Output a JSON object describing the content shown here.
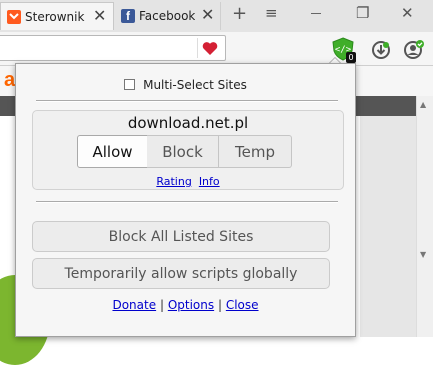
{
  "tabs": [
    {
      "title": "Sterowniki",
      "favicon": "sterowniki-favicon",
      "active": true
    },
    {
      "title": "Facebook",
      "favicon": "facebook-favicon",
      "active": false
    }
  ],
  "window_controls": {
    "new_tab": "+",
    "tab_list": "≡",
    "restore": "❐",
    "close": "✕"
  },
  "page": {
    "logo_char": "a"
  },
  "popup": {
    "multi_select_label": "Multi-Select Sites",
    "multi_select_checked": false,
    "site": "download.net.pl",
    "segments": [
      "Allow",
      "Block",
      "Temp"
    ],
    "selected_segment": "Allow",
    "site_links": {
      "rating": "Rating",
      "info": "Info"
    },
    "block_all": "Block All Listed Sites",
    "temp_allow": "Temporarily allow scripts globally",
    "footer": {
      "donate": "Donate",
      "sep": "|",
      "options": "Options",
      "close": "Close"
    }
  },
  "toolbar": {
    "noscript_badge": "0"
  },
  "colors": {
    "accent_green": "#3fae29",
    "heart_red": "#d42034",
    "logo_orange": "#ff6600",
    "link_blue": "#0000cc"
  }
}
